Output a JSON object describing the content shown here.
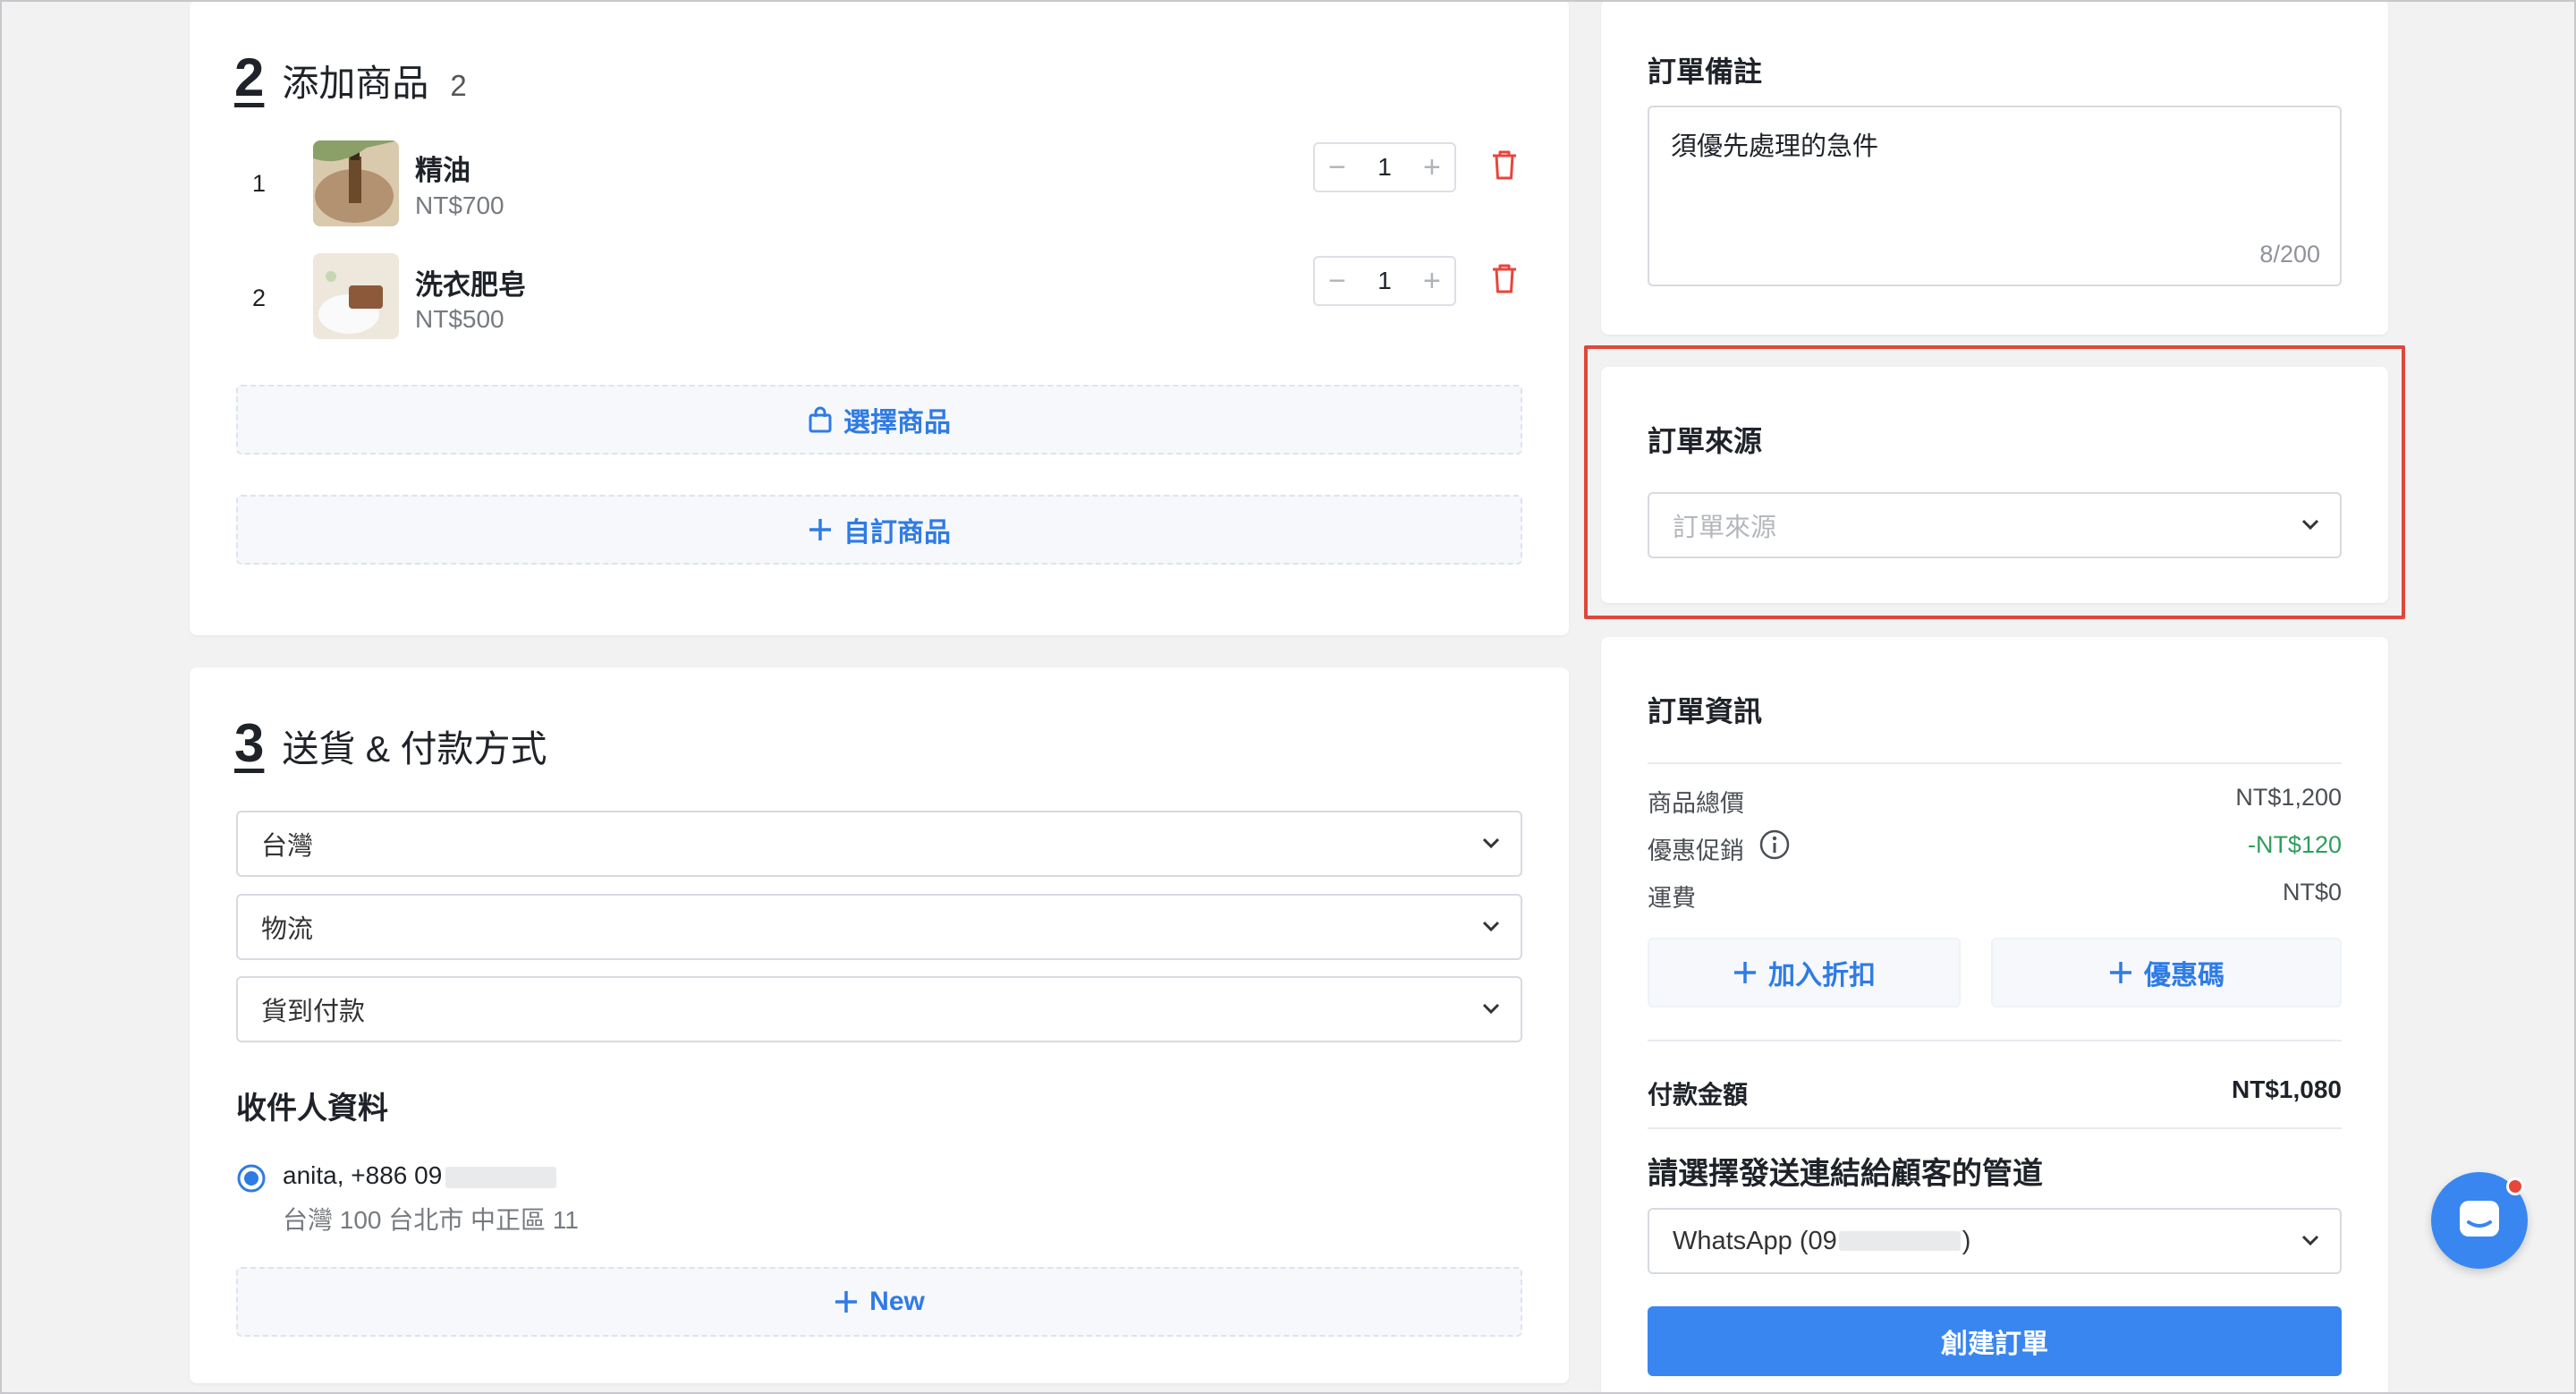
{
  "add_products": {
    "section_number": "2",
    "title": "添加商品",
    "count": "2",
    "items": [
      {
        "index": "1",
        "name": "精油",
        "price": "NT$700",
        "quantity": "1"
      },
      {
        "index": "2",
        "name": "洗衣肥皂",
        "price": "NT$500",
        "quantity": "1"
      }
    ],
    "select_products_label": "選擇商品",
    "custom_product_label": "自訂商品"
  },
  "shipping_payment": {
    "section_number": "3",
    "title": "送貨 & 付款方式",
    "country_value": "台灣",
    "delivery_value": "物流",
    "payment_value": "貨到付款",
    "recipient_heading": "收件人資料",
    "recipient_name_phone": "anita, +886 09",
    "recipient_address": "台灣 100 台北市 中正區 11",
    "new_label": "New"
  },
  "order_note": {
    "heading": "訂單備註",
    "value": "須優先處理的急件",
    "char_count": "8/200"
  },
  "order_source": {
    "heading": "訂單來源",
    "placeholder": "訂單來源"
  },
  "order_info": {
    "heading": "訂單資訊",
    "rows": [
      {
        "label": "商品總價",
        "value": "NT$1,200"
      },
      {
        "label": "優惠促銷",
        "value": "-NT$120"
      },
      {
        "label": "運費",
        "value": "NT$0"
      }
    ],
    "add_discount_label": "加入折扣",
    "coupon_label": "優惠碼",
    "total_label": "付款金額",
    "total_value": "NT$1,080",
    "channel_heading": "請選擇發送連結給顧客的管道",
    "channel_prefix": "WhatsApp (09",
    "channel_suffix": ")",
    "create_order_label": "創建訂單"
  },
  "colors": {
    "accent": "#3a86f0",
    "link": "#2f7be5",
    "discount_green": "#2e9e5b",
    "delete_red": "#e8453c",
    "highlight_red": "#e0463b"
  }
}
